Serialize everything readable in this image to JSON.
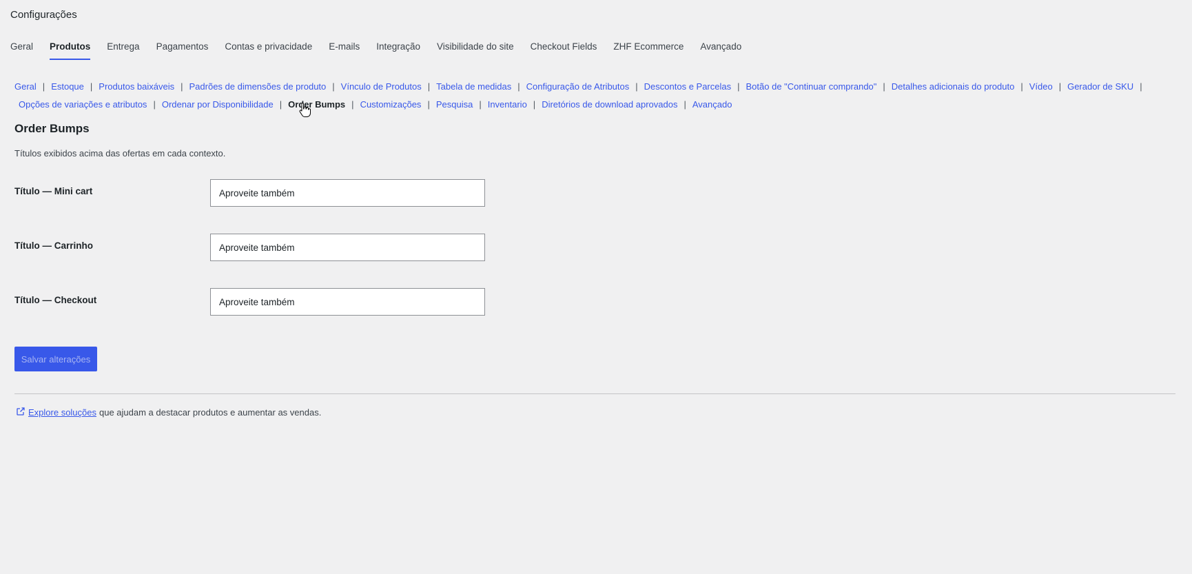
{
  "header": {
    "title": "Configurações"
  },
  "main_tabs": [
    {
      "label": "Geral",
      "active": false
    },
    {
      "label": "Produtos",
      "active": true
    },
    {
      "label": "Entrega",
      "active": false
    },
    {
      "label": "Pagamentos",
      "active": false
    },
    {
      "label": "Contas e privacidade",
      "active": false
    },
    {
      "label": "E-mails",
      "active": false
    },
    {
      "label": "Integração",
      "active": false
    },
    {
      "label": "Visibilidade do site",
      "active": false
    },
    {
      "label": "Checkout Fields",
      "active": false
    },
    {
      "label": "ZHF Ecommerce",
      "active": false
    },
    {
      "label": "Avançado",
      "active": false
    }
  ],
  "sub_nav": {
    "separator": "|",
    "items": [
      {
        "label": "Geral",
        "current": false
      },
      {
        "label": "Estoque",
        "current": false
      },
      {
        "label": "Produtos baixáveis",
        "current": false
      },
      {
        "label": "Padrões de dimensões de produto",
        "current": false
      },
      {
        "label": "Vínculo de Produtos",
        "current": false
      },
      {
        "label": "Tabela de medidas",
        "current": false
      },
      {
        "label": "Configuração de Atributos",
        "current": false
      },
      {
        "label": "Descontos e Parcelas",
        "current": false
      },
      {
        "label": "Botão de \"Continuar comprando\"",
        "current": false
      },
      {
        "label": "Detalhes adicionais do produto",
        "current": false
      },
      {
        "label": "Vídeo",
        "current": false
      },
      {
        "label": "Gerador de SKU",
        "current": false
      },
      {
        "label": "Opções de variações e atributos",
        "current": false
      },
      {
        "label": "Ordenar por Disponibilidade",
        "current": false
      },
      {
        "label": "Order Bumps",
        "current": true
      },
      {
        "label": "Customizações",
        "current": false
      },
      {
        "label": "Pesquisa",
        "current": false
      },
      {
        "label": "Inventario",
        "current": false
      },
      {
        "label": "Diretórios de download aprovados",
        "current": false
      },
      {
        "label": "Avançado",
        "current": false
      }
    ]
  },
  "section": {
    "title": "Order Bumps",
    "description": "Títulos exibidos acima das ofertas em cada contexto."
  },
  "fields": [
    {
      "label": "Título — Mini cart",
      "value": "Aproveite também"
    },
    {
      "label": "Título — Carrinho",
      "value": "Aproveite também"
    },
    {
      "label": "Título — Checkout",
      "value": "Aproveite também"
    }
  ],
  "save_button": {
    "label": "Salvar alterações"
  },
  "footer": {
    "link_text": "Explore soluções",
    "rest_text": "que ajudam a destacar produtos e aumentar as vendas.",
    "icon": "external-link-icon"
  },
  "colors": {
    "accent": "#3858e9",
    "background": "#f0f0f1"
  }
}
